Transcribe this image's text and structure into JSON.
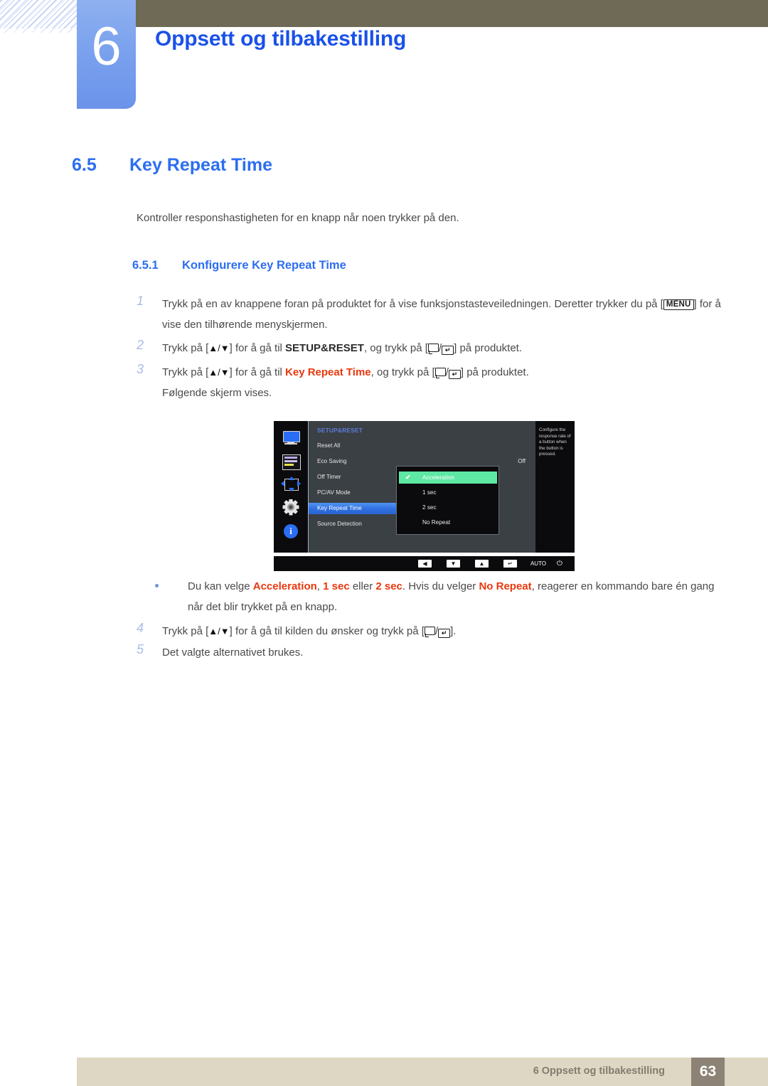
{
  "header": {
    "chapter_number": "6",
    "chapter_title": "Oppsett og tilbakestilling"
  },
  "section": {
    "number": "6.5",
    "title": "Key Repeat Time",
    "intro": "Kontroller responshastigheten for en knapp når noen trykker på den.",
    "subsection_number": "6.5.1",
    "subsection_title": "Konfigurere Key Repeat Time"
  },
  "steps": [
    {
      "num": "1",
      "part1": "Trykk på en av knappene foran på produktet for å vise funksjonstasteveiledningen. Deretter trykker du på [",
      "key": "MENU",
      "part2": "] for å vise den tilhørende menyskjermen."
    },
    {
      "num": "2",
      "part1": "Trykk på [",
      "arrows": "▲/▼",
      "part2": "] for å gå til ",
      "highlight": "SETUP&RESET",
      "part3": ", og trykk på [",
      "part4": "] på produktet."
    },
    {
      "num": "3",
      "part1": "Trykk på [",
      "arrows": "▲/▼",
      "part2": "] for å gå til ",
      "highlight": "Key Repeat Time",
      "part3": ", og trykk på [",
      "part4": "] på produktet.",
      "extra": "Følgende skjerm vises."
    },
    {
      "num": "4",
      "part1": "Trykk på [",
      "arrows": "▲/▼",
      "part2": "] for å gå til kilden du ønsker og trykk på [",
      "part4": "]."
    },
    {
      "num": "5",
      "part1": "Det valgte alternativet brukes."
    }
  ],
  "bullet": {
    "part1": "Du kan velge ",
    "opt1": "Acceleration",
    "part2": ", ",
    "opt2": "1 sec",
    "part3": " eller ",
    "opt3": "2 sec",
    "part4": ". Hvis du velger ",
    "opt4": "No Repeat",
    "part5": ", reagerer en kommando bare én gang når det blir trykket på en knapp."
  },
  "osd": {
    "category": "SETUP&RESET",
    "icons": [
      "monitor-icon",
      "osd-list-icon",
      "position-arrows-icon",
      "gear-icon",
      "info-icon"
    ],
    "menu_items": [
      {
        "label": "Reset All",
        "value": ""
      },
      {
        "label": "Eco Saving",
        "value": "Off"
      },
      {
        "label": "Off Timer",
        "value": ""
      },
      {
        "label": "PC/AV Mode",
        "value": ""
      },
      {
        "label": "Key Repeat Time",
        "value": "",
        "selected": true
      },
      {
        "label": "Source Detection",
        "value": ""
      }
    ],
    "submenu": [
      {
        "label": "Acceleration",
        "checked": true
      },
      {
        "label": "1 sec",
        "checked": false
      },
      {
        "label": "2 sec",
        "checked": false
      },
      {
        "label": "No Repeat",
        "checked": false
      }
    ],
    "help_text": "Configure the response rate of a button when the button is pressed.",
    "buttons": [
      {
        "glyph": "◀",
        "name": "left-button"
      },
      {
        "glyph": "▼",
        "name": "down-button"
      },
      {
        "glyph": "▲",
        "name": "up-button"
      },
      {
        "glyph": "↵",
        "name": "enter-button"
      },
      {
        "glyph": "AUTO",
        "name": "auto-button"
      },
      {
        "glyph": "⏻",
        "name": "power-button"
      }
    ],
    "colors": {
      "selected_item": "#2f6fe0",
      "checked_item": "#5ee8a3",
      "category_text": "#5b7bdc",
      "panel_bg": "#3b4044",
      "screen_bg": "#0b0b0d"
    }
  },
  "footer": {
    "text": "6 Oppsett og tilbakestilling",
    "page": "63"
  },
  "theme": {
    "heading_blue": "#2c6ef0",
    "title_blue": "#1a51e8",
    "accent_red": "#e8380d",
    "header_bar": "#6e6a55",
    "footer_bar": "#ddd7c3",
    "page_box": "#8c8275"
  }
}
